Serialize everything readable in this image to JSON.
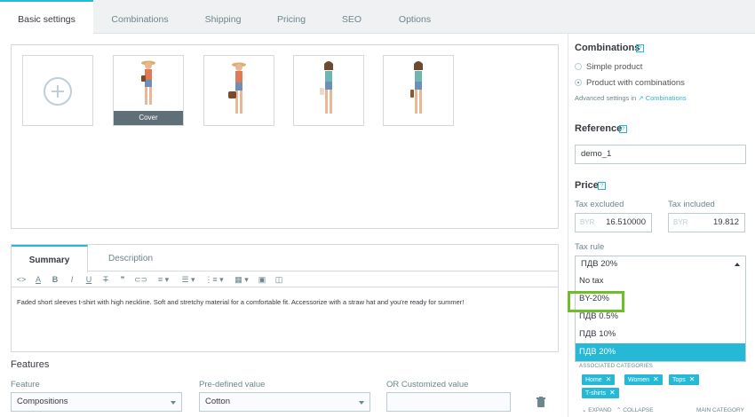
{
  "tabs": [
    "Basic settings",
    "Combinations",
    "Shipping",
    "Pricing",
    "SEO",
    "Options"
  ],
  "images": {
    "cover_label": "Cover"
  },
  "editor": {
    "tabs": [
      "Summary",
      "Description"
    ],
    "summary_text": "Faded short sleeves t-shirt with high neckline. Soft and stretchy material for a comfortable fit. Accessorize with a straw hat and you're ready for summer!"
  },
  "features": {
    "title": "Features",
    "feature_label": "Feature",
    "feature_value": "Compositions",
    "predefined_label": "Pre-defined value",
    "predefined_value": "Cotton",
    "custom_label": "OR Customized value"
  },
  "sidebar": {
    "combinations_title": "Combinations",
    "simple_product": "Simple product",
    "product_with_combinations": "Product with combinations",
    "advanced_settings": "Advanced settings in",
    "advanced_link": "Combinations",
    "reference_title": "Reference",
    "reference_value": "demo_1",
    "price_title": "Price",
    "tax_excluded_label": "Tax excluded",
    "tax_included_label": "Tax included",
    "currency": "BYR",
    "tax_excluded_value": "16.510000",
    "tax_included_value": "19.812",
    "tax_rule_label": "Tax rule",
    "tax_rule_value": "ПДВ 20%",
    "tax_options": [
      "No tax",
      "BY-20%",
      "ПДВ 0.5%",
      "ПДВ 10%",
      "ПДВ 20%"
    ],
    "associated_categories": "ASSOCIATED CATEGORIES",
    "categories": [
      "Home",
      "Women",
      "Tops",
      "T-shirts"
    ],
    "expand": "EXPAND",
    "collapse": "COLLAPSE",
    "main_category": "MAIN CATEGORY"
  },
  "colors": {
    "accent": "#25b9d7",
    "highlight": "#6cbf29"
  }
}
